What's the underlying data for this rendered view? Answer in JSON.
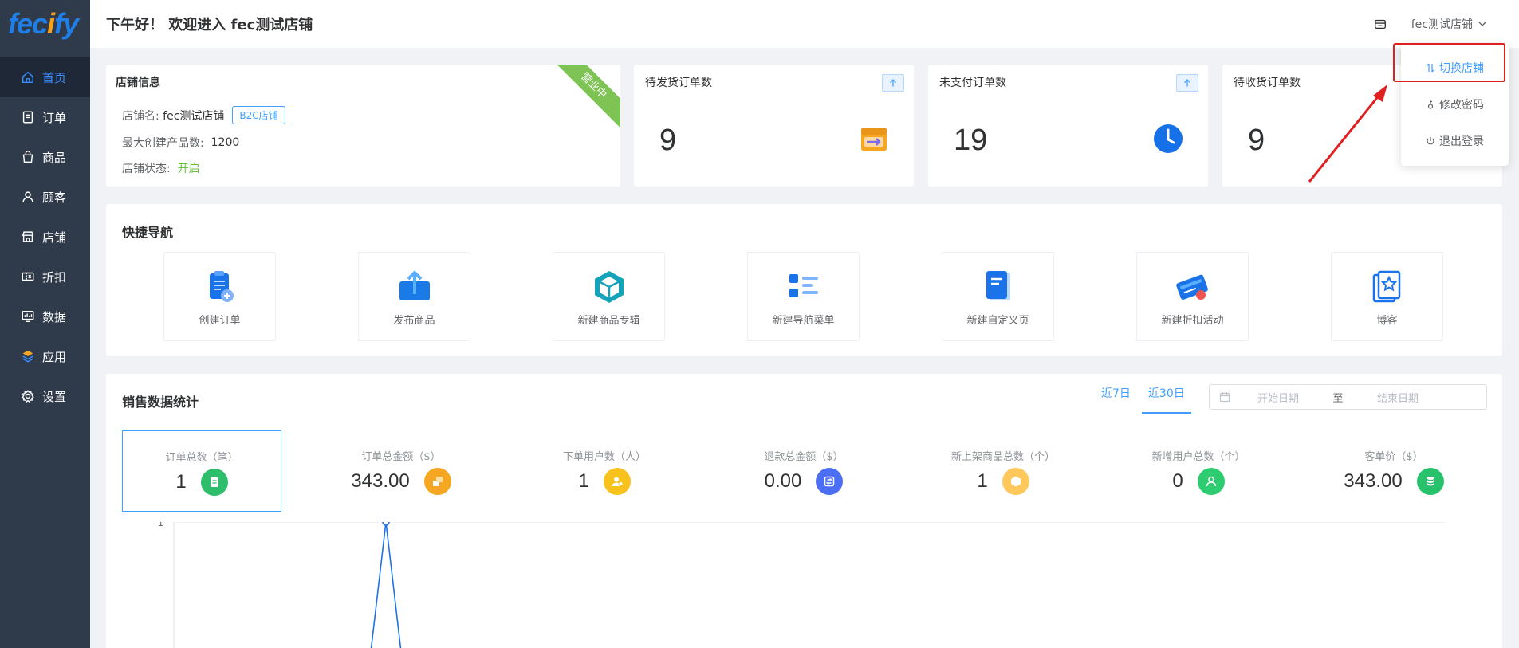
{
  "logo": {
    "main": "fec",
    "accent": "i",
    "tail": "fy"
  },
  "sidebar": {
    "items": [
      {
        "label": "首页",
        "icon": "home-icon",
        "active": true
      },
      {
        "label": "订单",
        "icon": "order-icon"
      },
      {
        "label": "商品",
        "icon": "bag-icon"
      },
      {
        "label": "顾客",
        "icon": "user-icon"
      },
      {
        "label": "店铺",
        "icon": "shop-icon"
      },
      {
        "label": "折扣",
        "icon": "coupon-icon"
      },
      {
        "label": "数据",
        "icon": "chart-icon"
      },
      {
        "label": "应用",
        "icon": "app-icon"
      },
      {
        "label": "设置",
        "icon": "gear-icon"
      }
    ]
  },
  "header": {
    "greeting": "下午好！ 欢迎进入 fec测试店铺",
    "user": "fec测试店铺"
  },
  "dropdown": {
    "items": [
      "切换店铺",
      "修改密码",
      "退出登录"
    ]
  },
  "store_info": {
    "title": "店铺信息",
    "ribbon": "营业中",
    "name_label": "店铺名:",
    "name_value": "fec测试店铺",
    "tag": "B2C店铺",
    "max_label": "最大创建产品数:",
    "max_value": "1200",
    "status_label": "店铺状态:",
    "status_value": "开启"
  },
  "stats": [
    {
      "title": "待发货订单数",
      "value": "9"
    },
    {
      "title": "未支付订单数",
      "value": "19"
    },
    {
      "title": "待收货订单数",
      "value": "9"
    }
  ],
  "quick_nav": {
    "title": "快捷导航",
    "items": [
      "创建订单",
      "发布商品",
      "新建商品专辑",
      "新建导航菜单",
      "新建自定义页",
      "新建折扣活动",
      "博客"
    ]
  },
  "sales": {
    "title": "销售数据统计",
    "tabs": [
      "近7日",
      "近30日"
    ],
    "start_placeholder": "开始日期",
    "separator": "至",
    "end_placeholder": "结束日期",
    "metrics": [
      {
        "label": "订单总数（笔）",
        "value": "1",
        "color": "#2ebd6b"
      },
      {
        "label": "订单总金额（$）",
        "value": "343.00",
        "color": "#f5a623"
      },
      {
        "label": "下单用户数（人）",
        "value": "1",
        "color": "#f7c21e"
      },
      {
        "label": "退款总金额（$）",
        "value": "0.00",
        "color": "#4c6ef5"
      },
      {
        "label": "新上架商品总数（个）",
        "value": "1",
        "color": "#ffc85c"
      },
      {
        "label": "新增用户总数（个）",
        "value": "0",
        "color": "#2ecc71"
      },
      {
        "label": "客单价（$）",
        "value": "343.00",
        "color": "#27c26b"
      }
    ]
  },
  "chart_data": {
    "type": "line",
    "y_tick_top": "1",
    "peak_value": 1
  }
}
